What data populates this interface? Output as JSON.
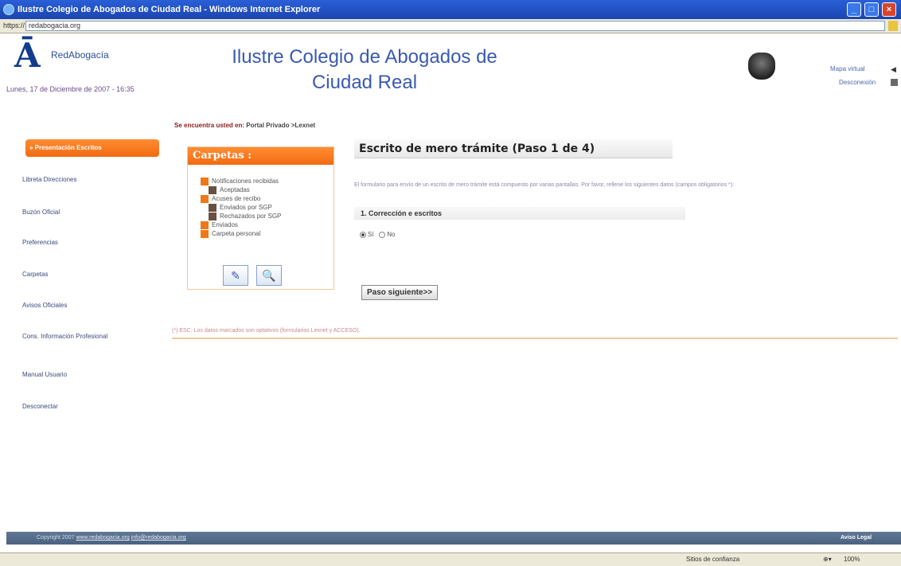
{
  "window": {
    "title": "Ilustre Colegio de Abogados de Ciudad Real - Windows Internet Explorer",
    "address_label": "https://",
    "url": "redabogacia.org"
  },
  "header": {
    "logo_name": "RedAbogacía",
    "date": "Lunes, 17 de Diciembre de 2007 - 16:35",
    "site_title_line1": "Ilustre Colegio de Abogados de",
    "site_title_line2": "Ciudad Real",
    "mapa_label": "Mapa virtual",
    "desconexion_label": "Desconexión"
  },
  "breadcrumb": {
    "label": "Se encuentra usted en:",
    "path": "Portal Privado >Lexnet"
  },
  "sidebar": {
    "items": [
      {
        "label": "» Presentación Escritos"
      },
      {
        "label": "Libreta Direcciones"
      },
      {
        "label": "Buzón Oficial"
      },
      {
        "label": "Preferencias"
      },
      {
        "label": "Carpetas"
      },
      {
        "label": "Avisos Oficiales"
      },
      {
        "label": "Cons. Información Profesional"
      },
      {
        "label": "Manual Usuario"
      },
      {
        "label": "Desconectar"
      }
    ]
  },
  "carpetas": {
    "header": "Carpetas :",
    "items": [
      {
        "label": "Notificaciones recibidas"
      },
      {
        "label": "Aceptadas"
      },
      {
        "label": "Acuses de recibo"
      },
      {
        "label": "Enviados por SGP"
      },
      {
        "label": "Rechazados por SGP"
      },
      {
        "label": "Enviados"
      },
      {
        "label": "Carpeta personal"
      }
    ]
  },
  "form": {
    "title": "Escrito de mero trámite (Paso 1 de 4)",
    "instructions": "El formulario para envío de un escrito de mero trámite está compuesto por varias pantallas. Por favor, rellene los siguientes datos (campos obligatorios *):",
    "section_title": "1. Corrección e escritos",
    "radio_yes": "Sí",
    "radio_no": "No",
    "next_button": "Paso siguiente>>"
  },
  "note": "(*) ESC: Los datos marcados son optativos (formularios Lexnet y ACCESO).",
  "footer": {
    "copyright": "Copyright 2007",
    "link1": "www.redabogacia.org",
    "link2": "info@redabogacia.org",
    "right": "Aviso Legal"
  },
  "statusbar": {
    "zone": "Sitios de confianza",
    "zoom": "100%"
  }
}
